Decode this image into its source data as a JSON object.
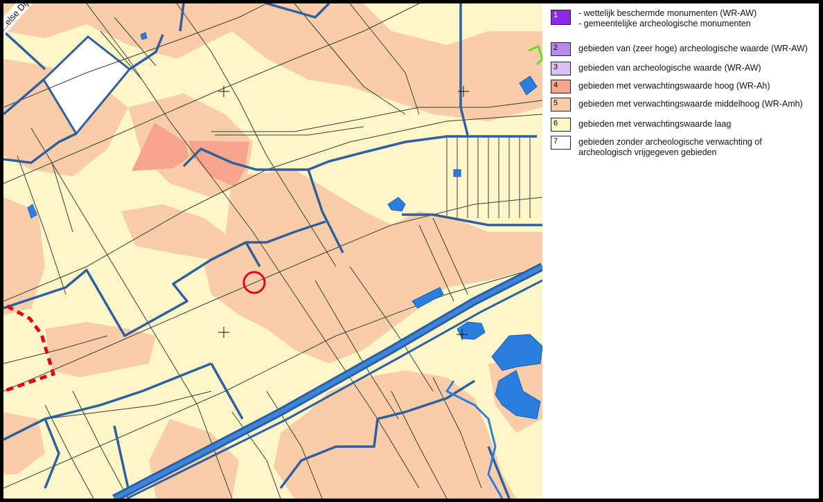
{
  "map": {
    "road_label": "...else Dijk",
    "layers": {
      "high_expectation_color": "#f7a58c",
      "medium_high_expectation_color": "#f8cda8",
      "low_expectation_color": "#fdf6c9",
      "boundary_color": "#2f5f9e",
      "water_color": "#2a7fde",
      "marker_color": "#e3001b"
    }
  },
  "legend": {
    "items": [
      {
        "number": "1",
        "color": "#8b2be6",
        "label_line1": "- wettelijk beschermde monumenten (WR-AW)",
        "label_line2": "- gemeentelijke archeologische monumenten"
      },
      {
        "number": "2",
        "color": "#b88ae8",
        "label_line1": "gebieden van (zeer hoge) archeologische waarde (WR-AW)",
        "label_line2": ""
      },
      {
        "number": "3",
        "color": "#dcc0f2",
        "label_line1": "gebieden  van archeologische waarde (WR-AW)",
        "label_line2": ""
      },
      {
        "number": "4",
        "color": "#f7a58c",
        "label_line1": "gebieden met verwachtingswaarde hoog (WR-Ah)",
        "label_line2": ""
      },
      {
        "number": "5",
        "color": "#f8cda8",
        "label_line1": "gebieden met verwachtingswaarde  middelhoog (WR-Amh)",
        "label_line2": ""
      },
      {
        "number": "6",
        "color": "#fdf6c9",
        "label_line1": "gebieden met verwachtingswaarde laag",
        "label_line2": ""
      },
      {
        "number": "7",
        "color": "#ffffff",
        "label_line1": "gebieden zonder archeologische verwachting of",
        "label_line2": "archeologisch vrijgegeven gebieden"
      }
    ]
  }
}
